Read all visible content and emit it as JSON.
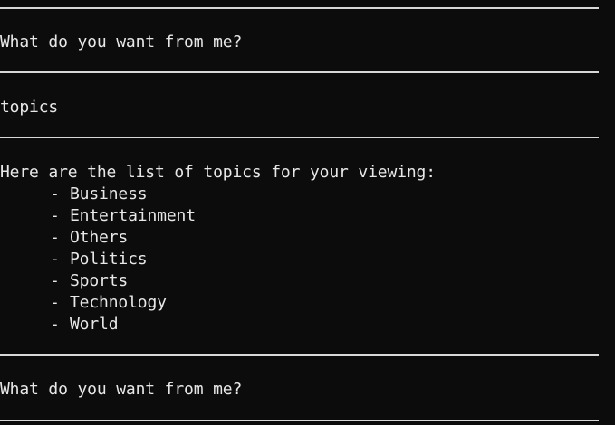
{
  "terminal": {
    "prompt_1": "What do you want from me?",
    "user_input": "topics",
    "response_header": "Here are the list of topics for your viewing:",
    "bullet": "-",
    "topics": [
      "Business",
      "Entertainment",
      "Others",
      "Politics",
      "Sports",
      "Technology",
      "World"
    ],
    "prompt_2": "What do you want from me?"
  }
}
